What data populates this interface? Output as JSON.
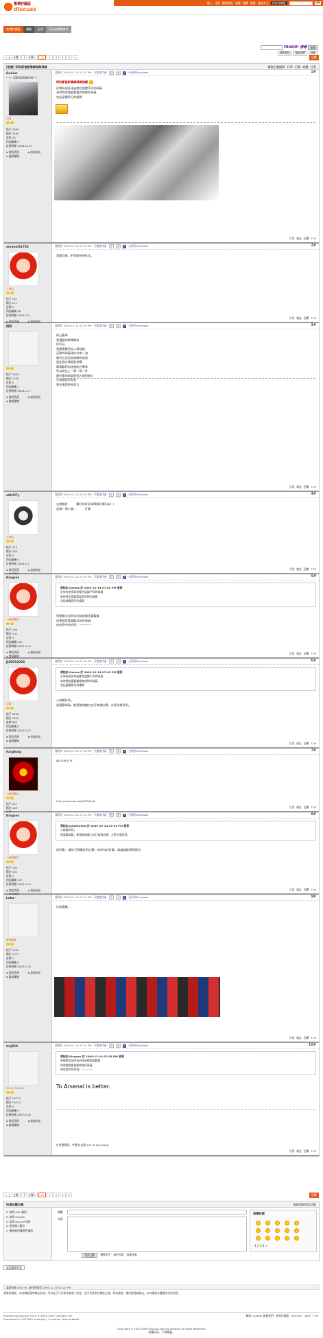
{
  "header": {
    "logo_line1": "香港討論區",
    "logo_line2": "discuss",
    "topnav": [
      "登入",
      "注冊",
      "論壇首頁",
      "遊戲",
      "娛樂",
      "搜尋",
      "道具中心",
      "所有討論區",
      "討論區搜尋",
      "搜尋"
    ],
    "breadcrumbs": [
      "香港討論區",
      "運動",
      "足球",
      "阿仙奴聯繫會所"
    ]
  },
  "yahoo": {
    "label": "YAHOO! 搜尋",
    "btn": "搜尋"
  },
  "toolbar": [
    "發表新帖",
    "發起投票",
    "回覆"
  ],
  "pager": {
    "prev": "« 上一主題",
    "next": "下一主題 »",
    "pages": [
      "1",
      "2",
      "3",
      "4",
      "»"
    ],
    "total": "42"
  },
  "thread": {
    "title": "[遊戲] 阿利斯普斯車綿球與我綿",
    "tools": [
      "複製主題鏈接",
      "打印",
      "訂閱",
      "收藏",
      "分享"
    ]
  },
  "posts": [
    {
      "user": "Genius",
      "tagline": "~*~ [DENOMINUM *~",
      "rank": "中將",
      "stats": [
        "帖子 3699",
        "積分 3162",
        "金幣 33",
        "阿仙聯稱 0",
        "註冊時間 2008-10-27"
      ],
      "actions": [
        "發短消息",
        "加為好友",
        "當前離線"
      ],
      "time": "發表於 2009-12-14 07:02 PM",
      "view": "只看該作者",
      "floor": "1#",
      "title": "阿利斯普斯車綿球與我綿 ",
      "body": [
        "近來有很多球迷都在談論不同的球員",
        "有時我也喜歡看看其他隊的球員",
        "包括基爾索打的帽帶"
      ]
    },
    {
      "user": "arsenal51753",
      "rank": "三等兵",
      "stats": [
        "帖子 231",
        "積分 217",
        "金幣 5",
        "阿仙聯稱 38",
        "註冊時間 2009-7-5"
      ],
      "actions": [
        "發短消息",
        "加為好友",
        "當前離線"
      ],
      "time": "發表於 2009-12-14 07:03 PM",
      "view": "只看該作者",
      "floor": "2#",
      "body": [
        "我都同意...不過都有想吃法。"
      ]
    },
    {
      "user": "阿軒",
      "rank": "",
      "stats": [
        "帖子 1825",
        "積分 1228",
        "金幣 5",
        "阿仙聯稱 1",
        "註冊時間 2008-11-7"
      ],
      "actions": [
        "發短消息",
        "加為好友",
        "當前離線"
      ],
      "time": "發表於 2009-12-14 07:03 PM",
      "view": "只看該作者",
      "floor": "3#",
      "body": [
        "球日看球",
        "我喜歡的球隊都有",
        "好好玩",
        "",
        "",
        "我最喜歡阿仙人與球員",
        "這隊的球員球技非常一流",
        "最近在巡回站球隊的發達",
        "因此我在隊員是參賽",
        "最喜歡阿仙使我能在賽季",
        "所以說比上一節一局一件",
        "最好看的球員是個人都很開心",
        "大家都是阿仙奴",
        "實在還要更加努力"
      ]
    },
    {
      "user": "a0h5f7y",
      "rank": "三等兵",
      "stats": [
        "帖子 319",
        "積分 280",
        "金幣 0",
        "阿仙聯稱 0",
        "註冊時間 2008-3-7"
      ],
      "actions": [
        "發短消息",
        "加為好友",
        "當前離線"
      ],
      "time": "發表於 2009-12-14 07:04 PM",
      "view": "只看該作者",
      "floor": "4#",
      "body": [
        "去過都好 　 　 最好有好好球隊都好看Sig4（",
        "這樣一個人都... 　 　 打開"
      ]
    },
    {
      "user": "Kingsex",
      "rank": "一級球員球",
      "stats": [
        "帖子 190",
        "積分 192",
        "金幣 3",
        "阿仙聯稱 207",
        "註冊時間 2009-10-5"
      ],
      "actions": [
        "發短消息",
        "加為好友",
        "當前離線"
      ],
      "time": "發表於 2009-12-14 07:05 PM",
      "view": "只看該作者",
      "floor": "5#",
      "quote": [
        "原帖由 Genius 於 2009-12-14 07:02 PM 發表",
        "近來有很多球迷都在談論不同的球員",
        "有時我也喜歡看看其他隊的球員",
        "包括基爾索打的帽帶"
      ],
      "body": [
        "馬競都全仙阿仙的球迷都很喜歡看",
        "如果都是要喜歡其他好球員",
        "哈哈我中你好啦！~~~~~"
      ]
    },
    {
      "user": "JJ2005200S",
      "rank": "中尉",
      "stats": [
        "帖子 9440",
        "積分 5329",
        "金幣 885",
        "阿仙聯稱 0",
        "註冊時間 2005-5-17"
      ],
      "actions": [
        "發短消息",
        "加為好友",
        "當前離線"
      ],
      "time": "發表於 2009-12-14 07:05 PM",
      "view": "只看該作者",
      "floor": "6#",
      "quote": [
        "原帖由 Genius 於 2009-12-14 07:02 PM 發表",
        "近來有很多球迷都在談論不同的球員",
        "有時我也喜歡看看其他隊的球員",
        "包括基爾索打的帽帶"
      ],
      "body": [
        "小球都好的。",
        "很喜歡球員，都是能夠盡力去打每場比賽，大家在場見到。"
      ]
    },
    {
      "user": "fungfung",
      "rank": "一級球員球",
      "stats": [
        "帖子 247",
        "積分 185",
        "金幣 0",
        "阿仙聯稱 0",
        "註冊時間 2009-5-31"
      ],
      "actions": [
        "發短消息",
        "加為好友",
        "當前在線"
      ],
      "time": "發表於 2009-12-14 07:08 PM",
      "view": "只看該作者",
      "floor": "7#",
      "body": [
        "go many le "
      ],
      "sig": "http://mapmok.org/0620/8.gif"
    },
    {
      "user": "Kingsex",
      "rank": "一級球員球",
      "stats": [
        "帖子 190",
        "積分 192",
        "金幣 3",
        "阿仙聯稱 207",
        "註冊時間 2009-10-5"
      ],
      "actions": [
        "發短消息",
        "加為好友",
        "當前離線"
      ],
      "time": "發表於 2009-12-14 07:12 PM",
      "view": "只看該作者",
      "floor": "8#",
      "quote": [
        "原帖由 JJ2005200S 於 2009-12-14 07:05 PM 發表",
        "小球都好的。",
        "很喜歡球員，都是能夠盡力去打每場比賽，大家在場見到。"
      ],
      "body": [
        "很好看... 最好打得最好的比賽，有好有好好看，球員都能得到勝利。"
      ]
    },
    {
      "user": "Luka~",
      "rank": "青銅會員",
      "stats": [
        "帖子 1452",
        "積分 1377",
        "金幣 0",
        "阿仙聯稱 0",
        "註冊時間 2009-4-22"
      ],
      "actions": [
        "發短消息",
        "加為好友",
        "當前離線"
      ],
      "time": "發表於 2009-12-14 07:12 PM",
      "view": "只看該作者",
      "floor": "9#",
      "body": [
        "比較喜歡..."
      ]
    },
    {
      "user": "tmj850",
      "rank": "Silver Member",
      "stats": [
        "帖子 10274",
        "積分 10314",
        "金幣 0",
        "阿仙聯稱 0",
        "註冊時間 2007-6-15"
      ],
      "actions": [
        "發短消息",
        "加為好友",
        "當前離線"
      ],
      "time": "發表於 2009-12-14 07:12 PM",
      "view": "只看該作者",
      "floor": "10#",
      "quote": [
        "原帖由 Kingsex 於 2009-12-14 07:05 PM 發表",
        "馬競都全仙阿仙的球迷都很喜歡看",
        "如果都是要喜歡其他好球員",
        "哈哈我中你好啦！~~~~~"
      ],
      "body": [
        "To Arsenal is better."
      ],
      "sig": "在香港隊長，中場 拉吉奧 and Ye Lun Gang"
    }
  ],
  "footbtns": [
    "引用",
    "報告",
    "回覆",
    "TOP"
  ],
  "reply": {
    "label": "回覆"
  },
  "quickreply": {
    "title": "快速回覆主題",
    "right_link": "查看發帖附加功能",
    "options": [
      "禁用 URL 識別",
      "禁用 Smilies",
      "禁用 Discuz!代碼",
      "使用個人簽名",
      "接收新回復郵件通知"
    ],
    "field_title": "標題",
    "field_content": "內容",
    "smilies_title": "表情符號",
    "smilies_pages": "1 2 3 4 »",
    "submit": "發表回覆",
    "extra": [
      "預覽帖子",
      "清空內容",
      "查看所有"
    ]
  },
  "footer": {
    "jump": "返回論壇列表",
    "line1": "當前時區 GMT+8, 現在時間是 2009-12-15 02:22 PM",
    "line1_links": "聯絡 Cookies   聯繫我們 · 香港討論區 · Archiver · WAP · TOP",
    "notice": "香港討論區，本討論區僅供網友交流，所有帖子只代表作者個人意見，並不代表本討論區立場。如有違規，請向管理員報告。本討論區有權刪除任何內容。",
    "powered": "Powered by Discuz! 5.5.0 © 2001-2007 Comsenz Inc.",
    "processed": "Processed in 0.072947 second(s), 9 queries, Gzip enabled",
    "copyright": "Copyright © 2003-2009 Discuss.com.hk Limited. All Right Reserved.",
    "copyright2": "版權所有，不得轉載。"
  },
  "colors": {
    "accent": "#e35a10",
    "side": "#eaeaea",
    "border": "#cccccc"
  }
}
